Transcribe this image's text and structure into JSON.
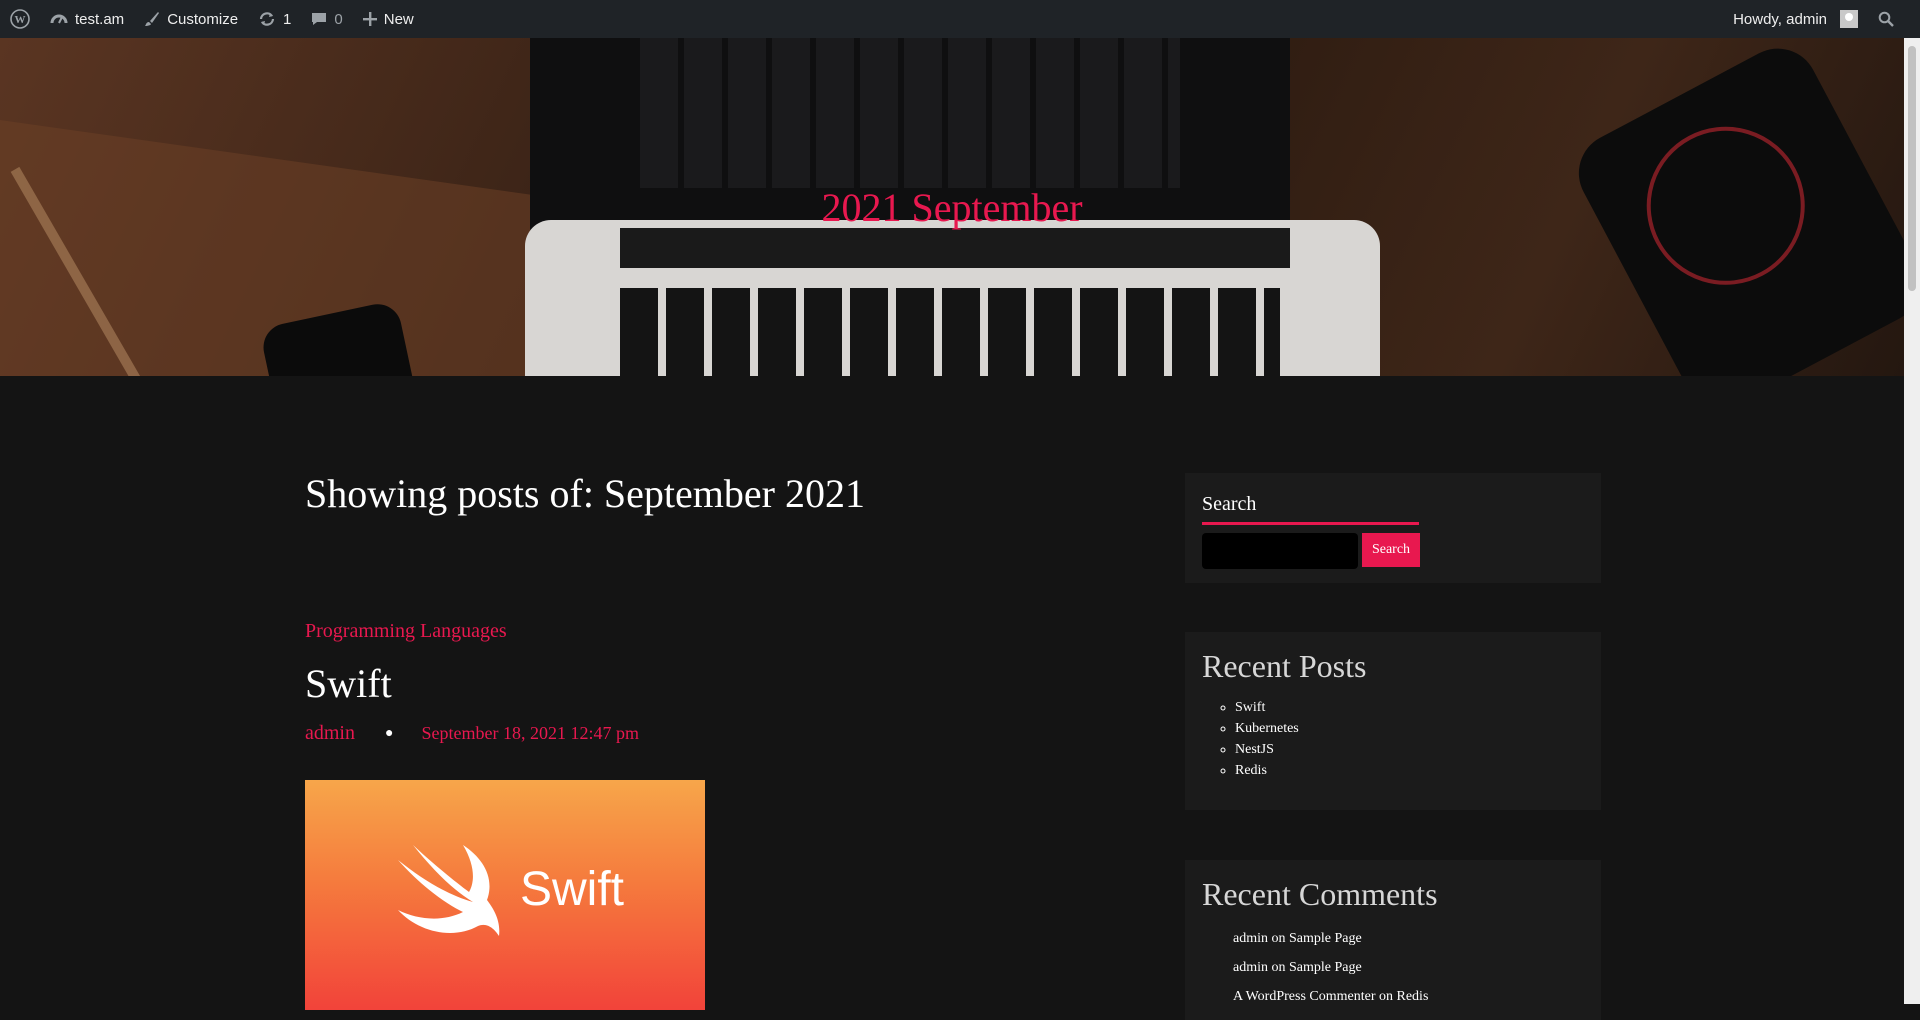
{
  "adminbar": {
    "site_name": "test.am",
    "customize": "Customize",
    "updates_count": "1",
    "comments_count": "0",
    "new_label": "New",
    "howdy": "Howdy, admin"
  },
  "hero": {
    "title": "2021 September"
  },
  "main": {
    "heading": "Showing posts of: September 2021",
    "post": {
      "category": "Programming Languages",
      "title": "Swift",
      "author": "admin",
      "date": "September 18, 2021 12:47 pm",
      "image_text": "Swift"
    }
  },
  "sidebar": {
    "search": {
      "title": "Search",
      "button": "Search",
      "value": ""
    },
    "recent_posts": {
      "title": "Recent Posts",
      "items": [
        "Swift",
        "Kubernetes",
        "NestJS",
        "Redis"
      ]
    },
    "recent_comments": {
      "title": "Recent Comments",
      "items": [
        {
          "author": "admin",
          "on": "on",
          "post": "Sample Page"
        },
        {
          "author": "admin",
          "on": "on",
          "post": "Sample Page"
        },
        {
          "author": "A WordPress Commenter",
          "on": "on",
          "post": "Redis"
        }
      ]
    }
  },
  "colors": {
    "accent": "#e8184f",
    "background": "#141414",
    "widget": "#1b1b1b",
    "adminbar": "#1f2327"
  }
}
